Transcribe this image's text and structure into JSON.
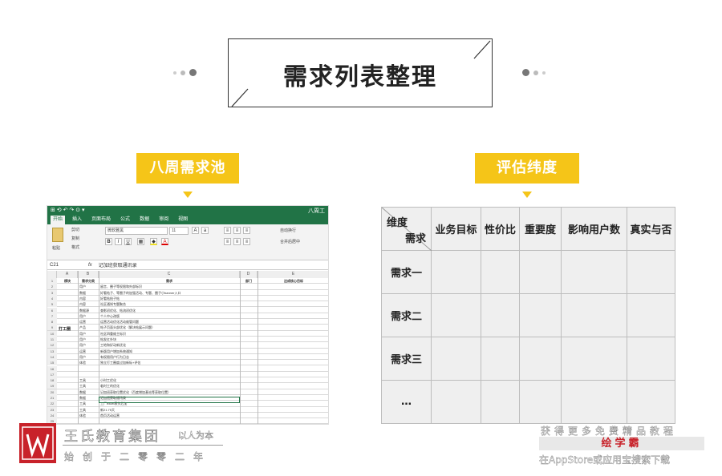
{
  "title": "需求列表整理",
  "left_label": "八周需求池",
  "right_label": "评估纬度",
  "colors": {
    "accent_yellow": "#f5c518",
    "excel_green": "#217346",
    "brand_red": "#c8222a"
  },
  "excel": {
    "window_title": "八周工",
    "quick_access": "⊞ ⟲ ↶ ↷ ⊙ ▾",
    "tabs": [
      "开始",
      "插入",
      "页面布局",
      "公式",
      "数据",
      "审阅",
      "视图"
    ],
    "ribbon": {
      "paste": "粘贴",
      "cut": "剪切",
      "copy": "复制",
      "format_painter": "格式",
      "font_name": "微软雅黑",
      "font_size": "11",
      "autowrap": "自动换行",
      "merge": "合并后居中"
    },
    "formula_bar": {
      "cell_ref": "C21",
      "fx": "fx",
      "content": "记加班获取通讯录"
    },
    "col_headers": [
      "A",
      "B",
      "C",
      "D",
      "E"
    ],
    "header_row": [
      "模块",
      "需求分类",
      "需求",
      "部门",
      "达成核心目标"
    ],
    "group_label": "打工圈",
    "rows": [
      {
        "n": "1",
        "b": "",
        "c": "",
        "d": ""
      },
      {
        "n": "2",
        "b": "用户",
        "c": "留言、圈子等权限和外部标识"
      },
      {
        "n": "3",
        "b": "数据",
        "c": "好看帖子、等圈子的加强活动、专题、圈子小banner入口"
      },
      {
        "n": "4",
        "b": "内容",
        "c": "好看帖抢子帖"
      },
      {
        "n": "5",
        "b": "内容",
        "c": "社区通知专题聚合"
      },
      {
        "n": "6",
        "b": "数据源",
        "c": "查影初优化、帖流初优化"
      },
      {
        "n": "7",
        "b": "用户",
        "c": "个人中心改版"
      },
      {
        "n": "8",
        "b": "运营",
        "c": "运营活动优化活动维管问题"
      },
      {
        "n": "9",
        "b": "产品",
        "c": "帖子页面头部优化（解决帖展示问题）"
      },
      {
        "n": "10",
        "b": "用户",
        "c": "社区四重维主标识"
      },
      {
        "n": "11",
        "b": "用户",
        "c": "帖发红外块"
      },
      {
        "n": "12",
        "b": "用户",
        "c": "工地和好动新优化"
      },
      {
        "n": "13",
        "b": "运营",
        "c": "新版用户增加系统通知"
      },
      {
        "n": "14",
        "b": "用户",
        "c": "有权限用户行为日志"
      },
      {
        "n": "15",
        "b": "体验",
        "c": "独立打工圈度过加新标+评估"
      },
      {
        "n": "16",
        "b": "",
        "c": ""
      },
      {
        "n": "17",
        "b": "",
        "c": ""
      },
      {
        "n": "18",
        "b": "工具",
        "c": "小时工优化"
      },
      {
        "n": "19",
        "b": "工具",
        "c": "临时工的优化"
      },
      {
        "n": "20",
        "b": "数据",
        "c": "记加班获取位置优化（百度增加基站等获取位置）"
      },
      {
        "n": "21",
        "b": "数据",
        "c": "记加班获取通讯录"
      },
      {
        "n": "22",
        "b": "工具",
        "c": "工厂excel表头后加"
      },
      {
        "n": "23",
        "b": "工具",
        "c": "新21.75天"
      },
      {
        "n": "24",
        "b": "体验",
        "c": "首页活动运营"
      },
      {
        "n": "25",
        "b": "",
        "c": ""
      }
    ]
  },
  "table": {
    "corner_top": "维度",
    "corner_bottom": "需求",
    "columns": [
      "业务目标",
      "性价比",
      "重要度",
      "影响用户数",
      "真实与否"
    ],
    "rows": [
      "需求一",
      "需求二",
      "需求三",
      "…"
    ]
  },
  "brand": {
    "name": "王氏教育集团",
    "slogan": "以人为本",
    "subtitle": "始创于二零零二年"
  },
  "watermark": {
    "line1": "获得更多免费精品教程",
    "app": "绘学霸",
    "line3": "在AppStore或应用宝搜索下载"
  }
}
